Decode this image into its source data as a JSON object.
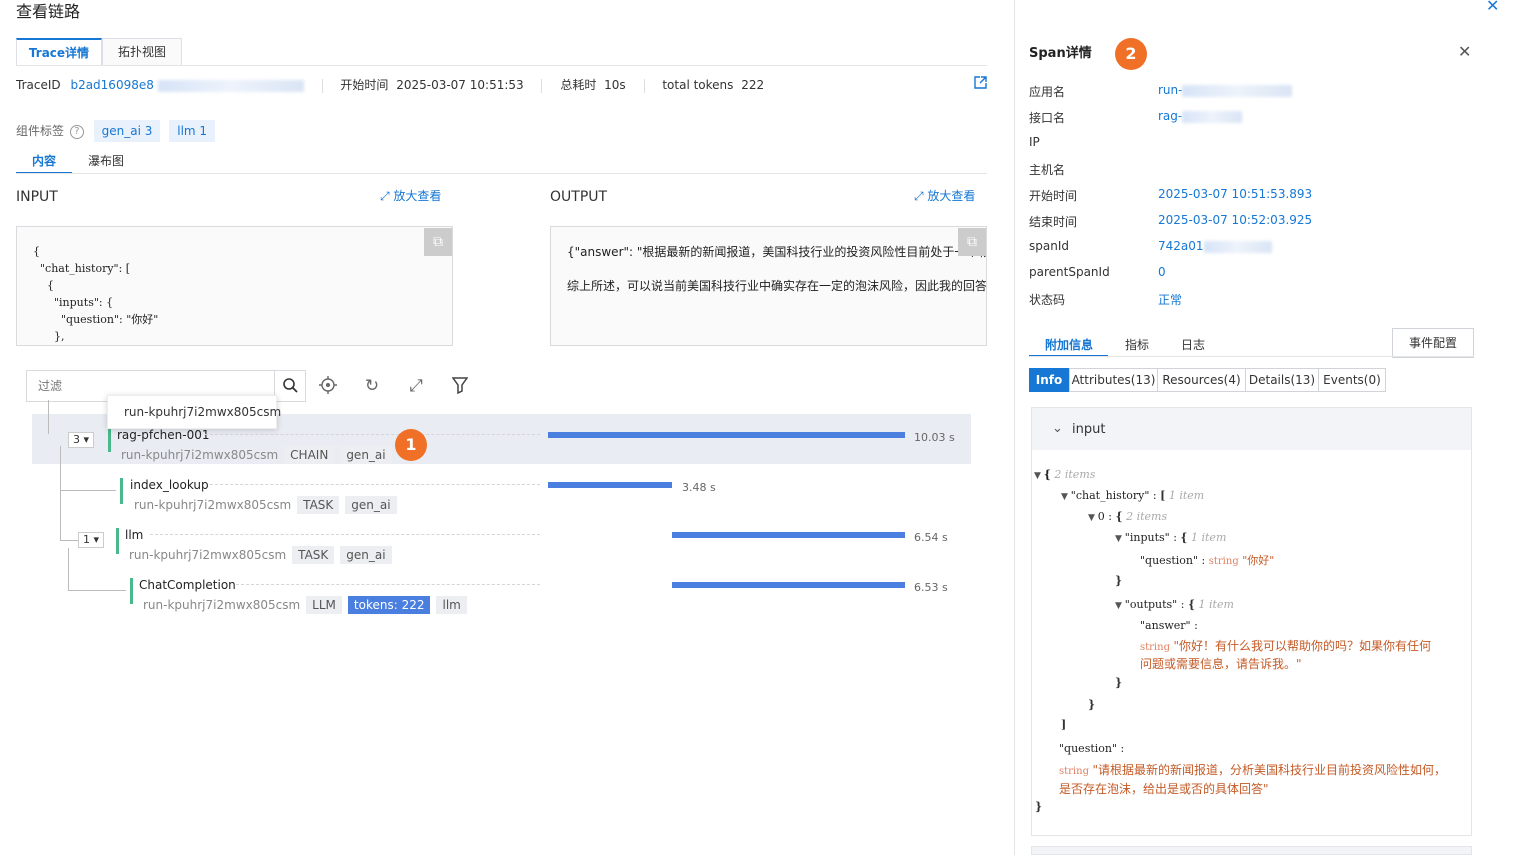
{
  "header": {
    "title": "查看链路",
    "close_glyph": "✕"
  },
  "left_tabs": [
    "Trace详情",
    "拓扑视图"
  ],
  "trace_info": {
    "trace_id_label": "TraceID",
    "trace_id_value": "b2ad16098e8",
    "start_label": "开始时间",
    "start_value": "2025-03-07 10:51:53",
    "duration_label": "总耗时",
    "duration_value": "10s",
    "tokens_label": "total tokens",
    "tokens_value": "222"
  },
  "component_tags": {
    "label": "组件标签",
    "tags": [
      "gen_ai 3",
      "llm 1"
    ]
  },
  "content_tabs": [
    "内容",
    "瀑布图"
  ],
  "input": {
    "title": "INPUT",
    "expand_label": "放大查看",
    "lines": [
      "{",
      "  \"chat_history\": [",
      "    {",
      "      \"inputs\": {",
      "        \"question\": \"你好\"",
      "      },"
    ]
  },
  "output": {
    "title": "OUTPUT",
    "expand_label": "放大查看",
    "lines": [
      "{\"answer\": \"根据最新的新闻报道，美国科技行业的投资风险性目前处于一个相",
      "综上所述，可以说当前美国科技行业中确实存在一定的泡沫风险，因此我的回答"
    ]
  },
  "filter": {
    "placeholder": "过滤",
    "tooltip": "run-kpuhrj7i2mwx805csm"
  },
  "spans": [
    {
      "name": "rag-pfchen-001",
      "run": "run-kpuhrj7i2mwx805csm",
      "kind": "CHAIN",
      "tags": [
        "gen_ai"
      ],
      "duration": "10.03 s",
      "collapse": "3",
      "highlighted": true
    },
    {
      "name": "index_lookup",
      "run": "run-kpuhrj7i2mwx805csm",
      "kind": "TASK",
      "tags": [
        "gen_ai"
      ],
      "duration": "3.48 s"
    },
    {
      "name": "llm",
      "run": "run-kpuhrj7i2mwx805csm",
      "kind": "TASK",
      "tags": [
        "gen_ai"
      ],
      "duration": "6.54 s",
      "collapse": "1"
    },
    {
      "name": "ChatCompletion",
      "run": "run-kpuhrj7i2mwx805csm",
      "kind": "LLM",
      "tokens": "tokens: 222",
      "tags": [
        "llm"
      ],
      "duration": "6.53 s"
    }
  ],
  "badges": [
    "1",
    "2"
  ],
  "span_detail": {
    "title": "Span详情",
    "fields": [
      {
        "label": "应用名",
        "value": "run-"
      },
      {
        "label": "接口名",
        "value": "rag-"
      },
      {
        "label": "IP",
        "value": ""
      },
      {
        "label": "主机名",
        "value": ""
      },
      {
        "label": "开始时间",
        "value": "2025-03-07 10:51:53.893"
      },
      {
        "label": "结束时间",
        "value": "2025-03-07 10:52:03.925"
      },
      {
        "label": "spanId",
        "value": "742a01"
      },
      {
        "label": "parentSpanId",
        "value": "0"
      },
      {
        "label": "状态码",
        "value": "正常"
      }
    ],
    "tabs": [
      "附加信息",
      "指标",
      "日志"
    ],
    "event_config": "事件配置",
    "sub_tabs": [
      "Info",
      "Attributes(13)",
      "Resources(4)",
      "Details(13)",
      "Events(0)"
    ],
    "section_title": "input"
  },
  "json_tree": {
    "items2": "2 items",
    "item1": "1 item",
    "k_chat_history": "\"chat_history\"",
    "k_0": "0",
    "k_inputs": "\"inputs\"",
    "k_question": "\"question\"",
    "v_question": "\"你好\"",
    "k_outputs": "\"outputs\"",
    "k_answer": "\"answer\"",
    "v_answer_1": "\"你好！有什么我可以帮助你的吗？如果你有任何",
    "v_answer_2": "问题或需要信息，请告诉我。\"",
    "v_question_top_1": "\"请根据最新的新闻报道，分析美国科技行业目前投资风险性如何，",
    "v_question_top_2": "是否存在泡沫，给出是或否的具体回答\"",
    "type_string": "string"
  }
}
